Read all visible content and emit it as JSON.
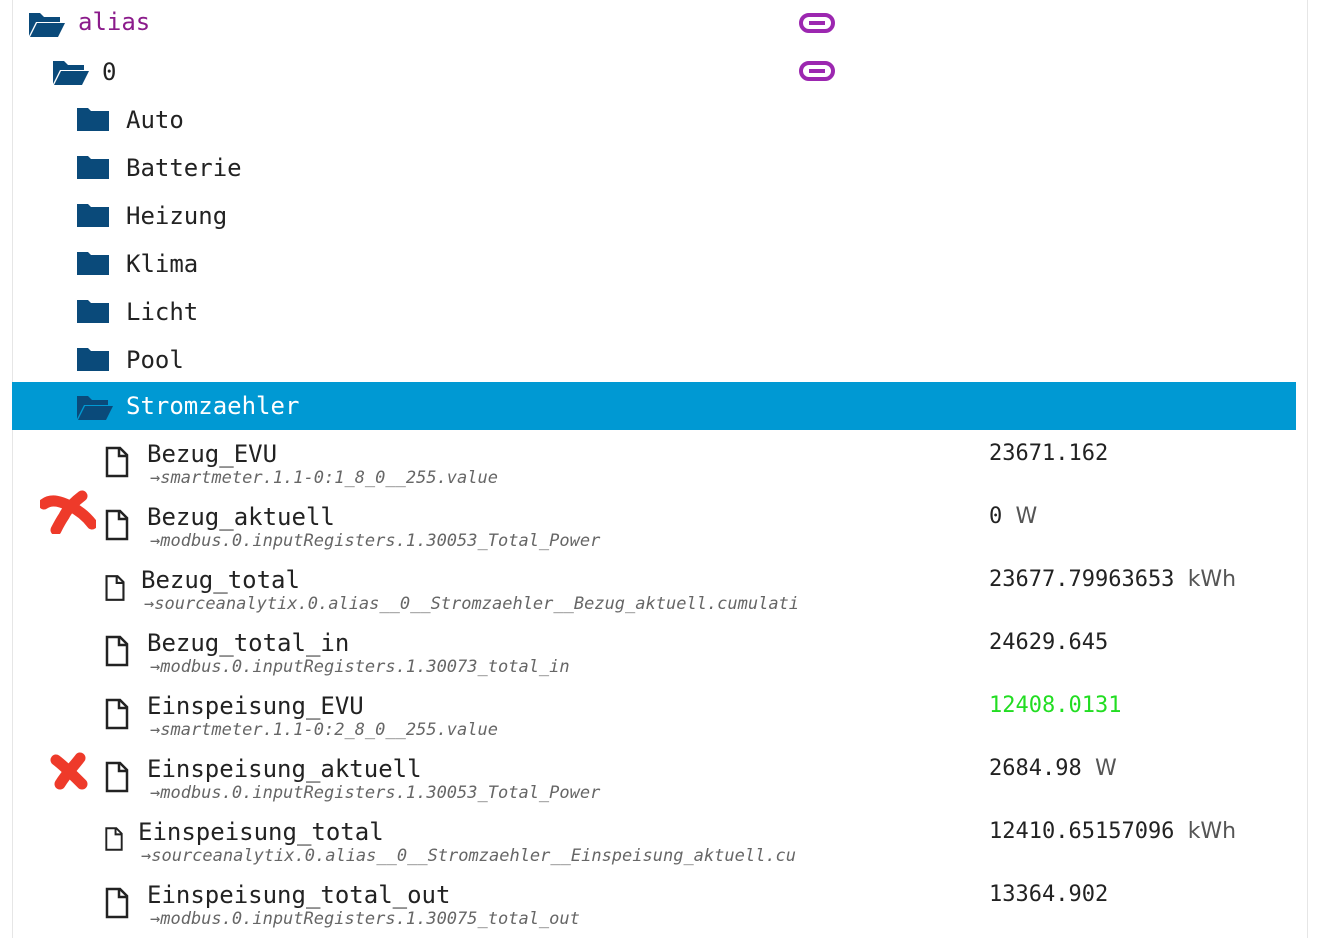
{
  "tree": {
    "alias": {
      "label": "alias",
      "color": "#8b1b8b"
    },
    "root0": {
      "label": "0"
    },
    "folders": [
      "Auto",
      "Batterie",
      "Heizung",
      "Klima",
      "Licht",
      "Pool"
    ],
    "selected": {
      "label": "Stromzaehler",
      "color": "#0099d3"
    }
  },
  "states": [
    {
      "name": "Bezug_EVU",
      "target": "→smartmeter.1.1-0:1_8_0__255.value",
      "value": "23671.162",
      "unit": ""
    },
    {
      "name": "Bezug_aktuell",
      "target": "→modbus.0.inputRegisters.1.30053_Total_Power",
      "value": "0",
      "unit": "W"
    },
    {
      "name": "Bezug_total",
      "target": "→sourceanalytix.0.alias__0__Stromzaehler__Bezug_aktuell.cumulati",
      "value": "23677.79963653",
      "unit": "kWh"
    },
    {
      "name": "Bezug_total_in",
      "target": "→modbus.0.inputRegisters.1.30073_total_in",
      "value": "24629.645",
      "unit": ""
    },
    {
      "name": "Einspeisung_EVU",
      "target": "→smartmeter.1.1-0:2_8_0__255.value",
      "value": "12408.0131",
      "unit": "",
      "highlight": "#22dd22"
    },
    {
      "name": "Einspeisung_aktuell",
      "target": "→modbus.0.inputRegisters.1.30053_Total_Power",
      "value": "2684.98",
      "unit": "W"
    },
    {
      "name": "Einspeisung_total",
      "target": "→sourceanalytix.0.alias__0__Stromzaehler__Einspeisung_aktuell.cu",
      "value": "12410.65157096",
      "unit": "kWh"
    },
    {
      "name": "Einspeisung_total_out",
      "target": "→modbus.0.inputRegisters.1.30075_total_out",
      "value": "13364.902",
      "unit": ""
    }
  ],
  "icons": {
    "folder": "folder-icon",
    "folder_open": "folder-open-icon",
    "file": "file-icon",
    "link": "link-icon",
    "annotation": "red-x-mark"
  },
  "colors": {
    "folder": "#0a4a7a",
    "link": "#9c27b0",
    "annotation": "#ee3a2a"
  }
}
